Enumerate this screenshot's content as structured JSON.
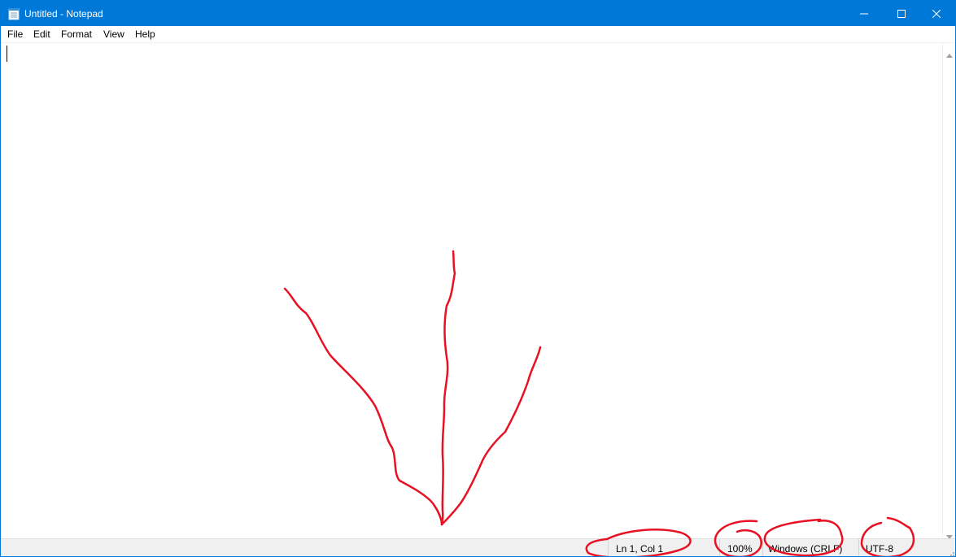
{
  "window": {
    "title": "Untitled - Notepad",
    "accent_color": "#0078d7",
    "app_icon": "notepad-icon"
  },
  "caption_buttons": {
    "minimize_icon": "minimize-icon",
    "maximize_icon": "maximize-icon",
    "close_icon": "close-icon"
  },
  "menu": {
    "items": [
      {
        "label": "File"
      },
      {
        "label": "Edit"
      },
      {
        "label": "Format"
      },
      {
        "label": "View"
      },
      {
        "label": "Help"
      }
    ]
  },
  "editor": {
    "text": ""
  },
  "statusbar": {
    "position": "Ln 1, Col 1",
    "zoom": "100%",
    "line_ending": "Windows (CRLF)",
    "encoding": "UTF-8"
  },
  "annotations": {
    "ink_color": "#e81123",
    "shapes": [
      "arrow-to-statusbar",
      "circle-ln-col",
      "circle-zoom",
      "circle-line-ending",
      "circle-encoding"
    ]
  }
}
